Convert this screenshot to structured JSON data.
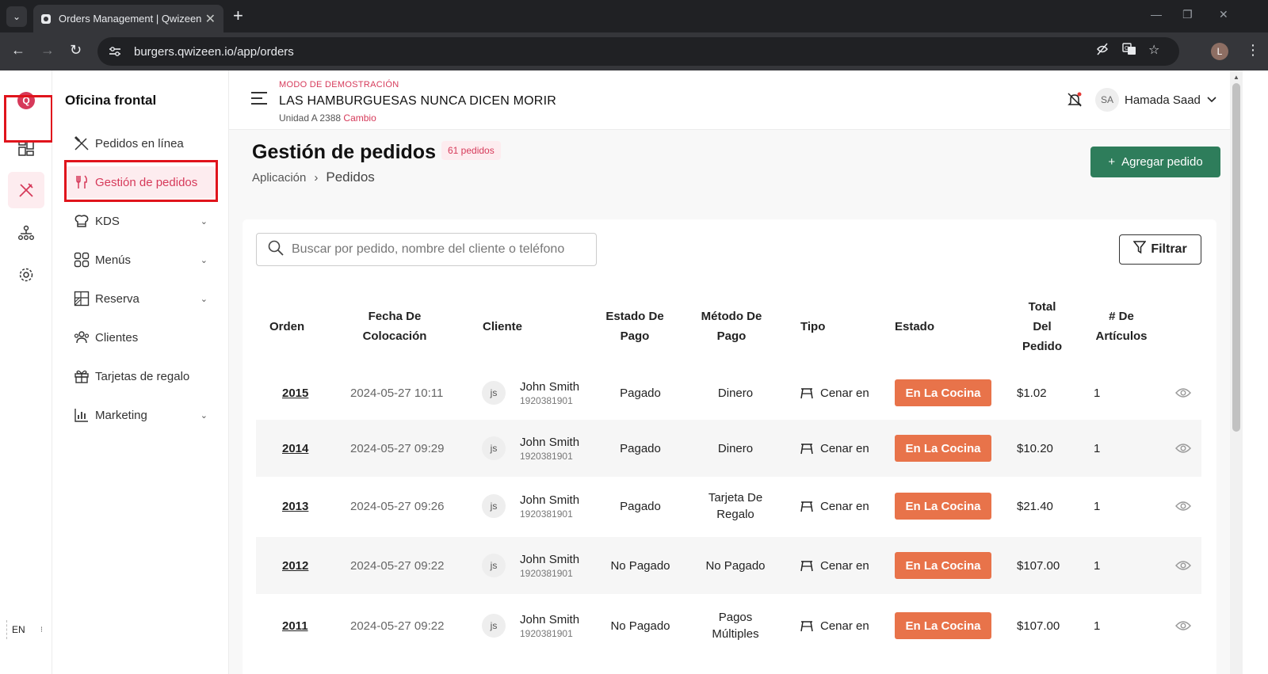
{
  "browser": {
    "tab_title": "Orders Management | Qwizeen",
    "url": "burgers.qwizeen.io/app/orders",
    "profile_initial": "L"
  },
  "rail": {
    "logo": "Q",
    "lang": "EN"
  },
  "side": {
    "title": "Oficina frontal",
    "items": [
      {
        "label": "Pedidos en línea",
        "icon": "cutlery-cross-icon",
        "has_chevron": false
      },
      {
        "label": "Gestión de pedidos",
        "icon": "fork-knife-icon",
        "has_chevron": false,
        "active": true
      },
      {
        "label": "KDS",
        "icon": "chef-hat-icon",
        "has_chevron": true
      },
      {
        "label": "Menús",
        "icon": "grid-icon",
        "has_chevron": true
      },
      {
        "label": "Reserva",
        "icon": "table-icon",
        "has_chevron": true
      },
      {
        "label": "Clientes",
        "icon": "users-icon",
        "has_chevron": false
      },
      {
        "label": "Tarjetas de regalo",
        "icon": "gift-icon",
        "has_chevron": false
      },
      {
        "label": "Marketing",
        "icon": "bar-chart-icon",
        "has_chevron": true
      }
    ]
  },
  "header": {
    "demo_mode": "MODO DE DEMOSTRACIÓN",
    "restaurant": "LAS HAMBURGUESAS NUNCA DICEN MORIR",
    "unit": "Unidad A 2388",
    "change": "Cambio",
    "user_initials": "SA",
    "user_name": "Hamada Saad"
  },
  "page": {
    "title": "Gestión de pedidos",
    "count_badge": "61 pedidos",
    "breadcrumb_root": "Aplicación",
    "breadcrumb_current": "Pedidos",
    "add_button": "Agregar pedido",
    "search_placeholder": "Buscar por pedido, nombre del cliente o teléfono",
    "filter_button": "Filtrar"
  },
  "table": {
    "columns": [
      "Orden",
      "Fecha De Colocación",
      "Cliente",
      "Estado De Pago",
      "Método De Pago",
      "Tipo",
      "Estado",
      "Total Del Pedido",
      "# De Artículos"
    ],
    "rows": [
      {
        "order": "2015",
        "date": "2024-05-27 10:11",
        "initials": "js",
        "name": "John Smith",
        "phone": "1920381901",
        "pay_status": "Pagado",
        "pay_method": "Dinero",
        "type": "Cenar en",
        "status": "En La Cocina",
        "total": "$1.02",
        "items": "1"
      },
      {
        "order": "2014",
        "date": "2024-05-27 09:29",
        "initials": "js",
        "name": "John Smith",
        "phone": "1920381901",
        "pay_status": "Pagado",
        "pay_method": "Dinero",
        "type": "Cenar en",
        "status": "En La Cocina",
        "total": "$10.20",
        "items": "1"
      },
      {
        "order": "2013",
        "date": "2024-05-27 09:26",
        "initials": "js",
        "name": "John Smith",
        "phone": "1920381901",
        "pay_status": "Pagado",
        "pay_method": "Tarjeta De Regalo",
        "type": "Cenar en",
        "status": "En La Cocina",
        "total": "$21.40",
        "items": "1"
      },
      {
        "order": "2012",
        "date": "2024-05-27 09:22",
        "initials": "js",
        "name": "John Smith",
        "phone": "1920381901",
        "pay_status": "No Pagado",
        "pay_method": "No Pagado",
        "type": "Cenar en",
        "status": "En La Cocina",
        "total": "$107.00",
        "items": "1"
      },
      {
        "order": "2011",
        "date": "2024-05-27 09:22",
        "initials": "js",
        "name": "John Smith",
        "phone": "1920381901",
        "pay_status": "No Pagado",
        "pay_method": "Pagos Múltiples",
        "type": "Cenar en",
        "status": "En La Cocina",
        "total": "$107.00",
        "items": "1"
      }
    ]
  },
  "colors": {
    "brand": "#d63a5a",
    "primary_button": "#2e7d5b",
    "status_kitchen": "#e8734a",
    "highlight_box": "#e0141c"
  }
}
